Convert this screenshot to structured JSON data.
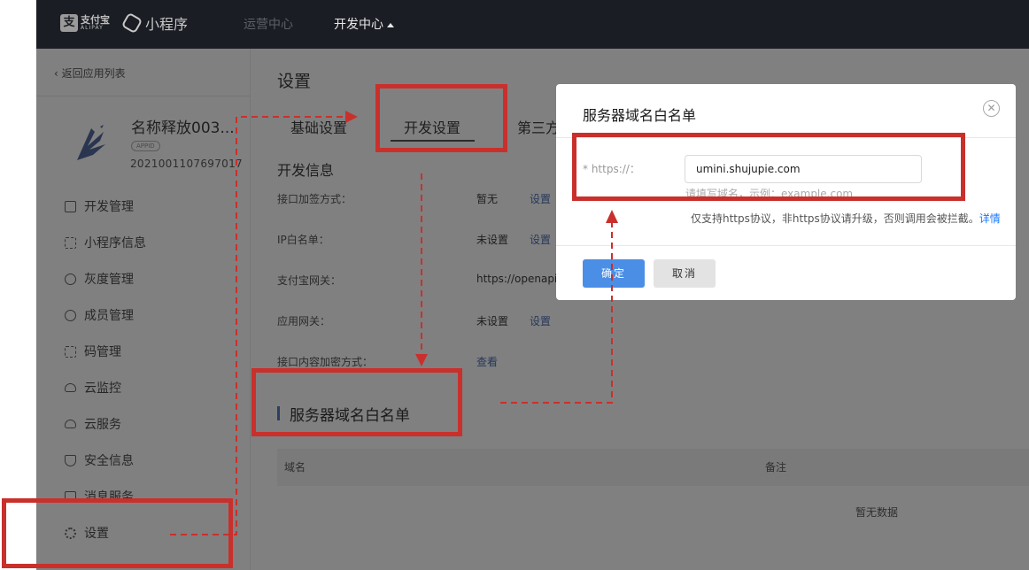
{
  "topbar": {
    "alipay_logo_text": "支付宝",
    "alipay_logo_sub": "ALIPAY",
    "alipay_mark": "支",
    "miniprogram_logo_text": "小程序",
    "nav_ops": "运营中心",
    "nav_dev": "开发中心"
  },
  "sidebar": {
    "back_link": "返回应用列表",
    "app_name": "名称释放003...",
    "app_badge": "APPID",
    "app_id": "2021001107697017",
    "menu": [
      {
        "label": "开发管理",
        "icon": "code-icon"
      },
      {
        "label": "小程序信息",
        "icon": "grid-icon"
      },
      {
        "label": "灰度管理",
        "icon": "broadcast-icon"
      },
      {
        "label": "成员管理",
        "icon": "user-icon"
      },
      {
        "label": "码管理",
        "icon": "qrcode-icon"
      },
      {
        "label": "云监控",
        "icon": "cloud-icon"
      },
      {
        "label": "云服务",
        "icon": "cloud-icon"
      },
      {
        "label": "安全信息",
        "icon": "shield-icon"
      },
      {
        "label": "消息服务",
        "icon": "message-icon"
      },
      {
        "label": "设置",
        "icon": "gear-icon"
      }
    ]
  },
  "main": {
    "title": "设置",
    "tabs": [
      "基础设置",
      "开发设置",
      "第三方"
    ],
    "section_title": "开发信息",
    "rows": [
      {
        "label": "接口加签方式：",
        "value": "暂无",
        "action": "设置"
      },
      {
        "label": "IP白名单：",
        "value": "未设置",
        "action": "设置"
      },
      {
        "label": "支付宝网关：",
        "value": "https://openapi",
        "action": ""
      },
      {
        "label": "应用网关：",
        "value": "未设置",
        "action": "设置"
      },
      {
        "label": "接口内容加密方式：",
        "value": "",
        "action": "查看"
      }
    ],
    "whitelist_heading": "服务器域名白名单",
    "table_columns": [
      "域名",
      "备注"
    ],
    "table_empty": "暂无数据"
  },
  "dialog": {
    "title": "服务器域名白名单",
    "field_label": "* https://：",
    "field_value": "umini.shujupie.com",
    "hint": "请填写域名，示例：example.com",
    "note": "仅支持https协议，非https协议请升级，否则调用会被拦截。",
    "note_link": "详情",
    "ok_label": "确定",
    "cancel_label": "取消"
  },
  "colors": {
    "annotation_red": "#c9302c",
    "primary_blue": "#4a8ee6",
    "topbar": "#1a1d23",
    "overlay_gray": "#808080"
  }
}
